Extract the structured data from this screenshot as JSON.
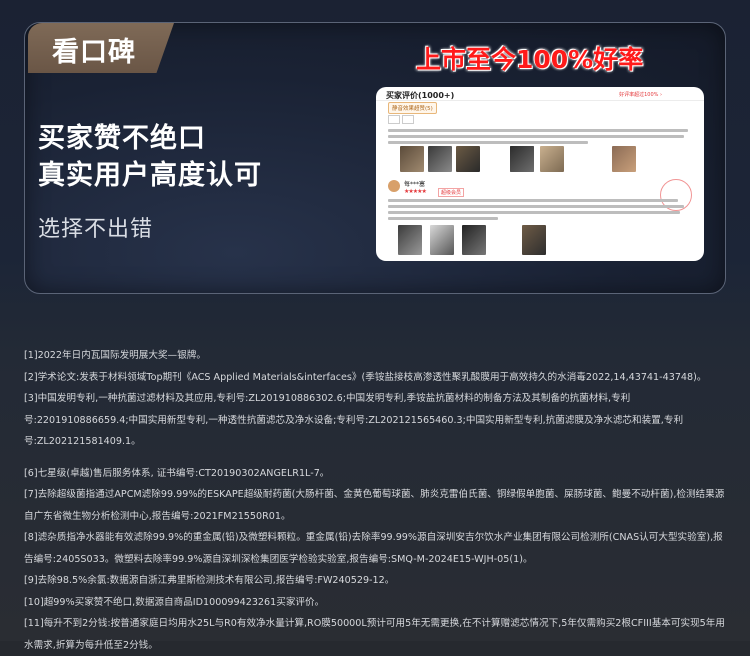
{
  "tag": {
    "label": "看口碑"
  },
  "headline": {
    "line1": "买家赞不绝口",
    "line2": "真实用户高度认可"
  },
  "subline": "选择不出错",
  "promo": "上市至今100%好率",
  "review_card": {
    "header": "买家评价(1000+)",
    "good_rate": "好评率超过100% ›",
    "filter_chip": "静音效果超赞(5)",
    "username": "每***塞",
    "stars": "★★★★★",
    "badge": "超级会员",
    "colors": {
      "accent": "#e4393c"
    }
  },
  "notes": {
    "group1": [
      "[1]2022年日内瓦国际发明展大奖—银牌。",
      "[2]学术论文:发表于材料领域Top期刊《ACS Applied Materials&interfaces》(季铵盐接枝高渗透性聚乳酸膜用于高效持久的水消毒2022,14,43741-43748)。",
      "[3]中国发明专利,一种抗菌过滤材料及其应用,专利号:ZL201910886302.6;中国发明专利,季铵盐抗菌材料的制备方法及其制备的抗菌材料,专利号:2201910886659.4;中国实用新型专利,一种透性抗菌滤芯及净水设备;专利号:ZL202121565460.3;中国实用新型专利,抗菌滤膜及净水滤芯和装置,专利号:ZL202121581409.1。"
    ],
    "group2": [
      "[6]七星级(卓越)售后服务体系, 证书编号:CT20190302ANGELR1L-7。",
      "[7]去除超级菌指通过APCM滤除99.99%的ESKAPE超级耐药菌(大肠杆菌、金黄色葡萄球菌、肺炎克雷伯氏菌、铜绿假单胞菌、屎肠球菌、鲍曼不动杆菌),检测结果源自广东省微生物分析检测中心,报告编号:2021FM21550R01。",
      "[8]滤杂质指净水器能有效滤除99.9%的重金属(铅)及微塑料颗粒。重金属(铅)去除率99.99%源自深圳安吉尔饮水产业集团有限公司检测所(CNAS认可大型实验室),报告编号:2405S033。微塑料去除率99.9%源自深圳深检集团医学检验实验室,报告编号:SMQ-M-2024E15-WJH-05(1)。",
      "[9]去除98.5%余氯:数据源自浙江弗里斯检测技术有限公司,报告编号:FW240529-12。",
      "[10]超99%买家赞不绝口,数据源自商品ID100099423261买家评价。",
      "[11]每升不到2分钱:按普通家庭日均用水25L与R0有效净水量计算,RO膜50000L预计可用5年无需更换,在不计算赠滤芯情况下,5年仅需购买2根CFIII基本可实现5年用水需求,折算为每升低至2分钱。"
    ]
  }
}
